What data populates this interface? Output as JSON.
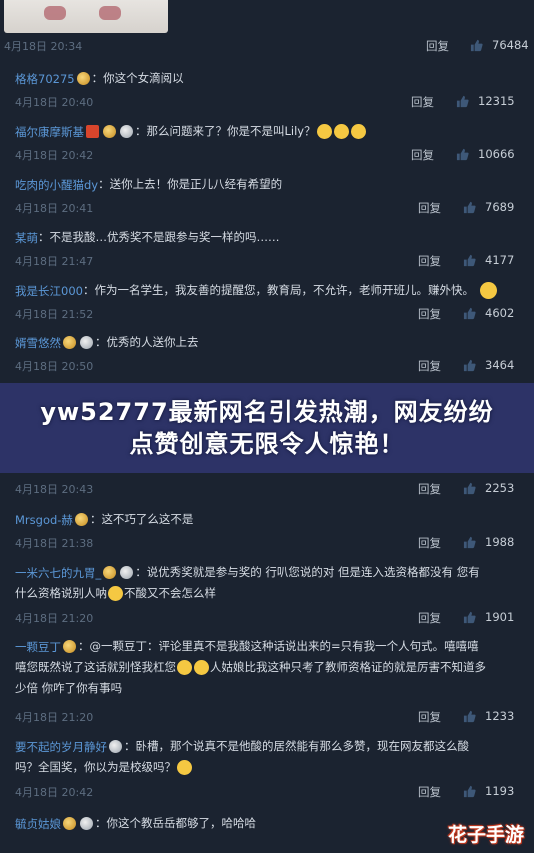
{
  "top_post": {
    "time": "4月18日 20:34",
    "reply_label": "回复",
    "likes": "76484"
  },
  "comments": [
    {
      "name": "格格70275",
      "text": "你这个女滴阅以",
      "time": "4月18日 20:40",
      "reply_label": "回复",
      "likes": "12315"
    },
    {
      "name": "福尔康摩斯基",
      "text": "那么问题来了？你是不是叫Lily？",
      "time": "4月18日 20:42",
      "reply_label": "回复",
      "likes": "10666"
    },
    {
      "name": "吃肉的小醒猫dy",
      "text": "送你上去！你是正儿八经有希望的",
      "time": "4月18日 20:41",
      "reply_label": "回复",
      "likes": "7689"
    },
    {
      "name": "某萌",
      "text": "不是我酸…优秀奖不是跟参与奖一样的吗……",
      "time": "4月18日 21:47",
      "reply_label": "回复",
      "likes": "4177"
    },
    {
      "name": "我是长江000",
      "text": "作为一名学生，我友善的提醒您，教育局，不允许，老师开班儿。赚外快。",
      "time": "4月18日 21:52",
      "reply_label": "回复",
      "likes": "4602"
    },
    {
      "name": "婿雪悠然",
      "text": "优秀的人送你上去",
      "time": "4月18日 20:50",
      "reply_label": "回复",
      "likes": "3464"
    },
    {
      "name": "Mrsgod-赫",
      "text": "这不巧了么这不是",
      "time": "4月18日 21:38",
      "reply_label": "回复",
      "likes": "1988"
    },
    {
      "name": "一米六七的九胃_",
      "text": "说优秀奖就是参与奖的 行叭您说的对 但是连入选资格都没有 您有",
      "text2": "什么资格说别人呐",
      "text2b": "不酸又不会怎么样",
      "time": "4月18日 21:20",
      "reply_label": "回复",
      "likes": "1901"
    },
    {
      "name": "一颗豆丁",
      "text": "@一颗豆丁：评论里真不是我酸这种话说出来的=只有我一个人句式。嘻嘻嘻",
      "text2": "嘻您既然说了这话就别怪我杠您",
      "text2b": "人姑娘比我这种只考了教师资格证的就是厉害不知道多",
      "text3": "少倍 你咋了你有事吗",
      "time": "4月18日 21:20",
      "reply_label": "回复",
      "likes": "1233"
    },
    {
      "name": "要不起的岁月静好",
      "text": "卧槽，那个说真不是他酸的居然能有那么多赞，现在网友都这么酸",
      "text2": "吗？全国奖，你以为是校级吗？",
      "time": "4月18日 20:42",
      "reply_label": "回复",
      "likes": "1193"
    },
    {
      "name": "毓贞姑娘",
      "text": "你这个教岳岳都够了，哈哈哈"
    }
  ],
  "hidden_comment": {
    "time": "4月18日 20:43",
    "reply_label": "回复",
    "likes": "2253"
  },
  "banner": {
    "line1": "yw52777最新网名引发热潮，网友纷纷",
    "line2": "点赞创意无限令人惊艳！"
  },
  "watermark": "花子手游",
  "colors": {
    "background": "#1b2330",
    "name": "#5b97d6",
    "banner": "#30366e"
  }
}
